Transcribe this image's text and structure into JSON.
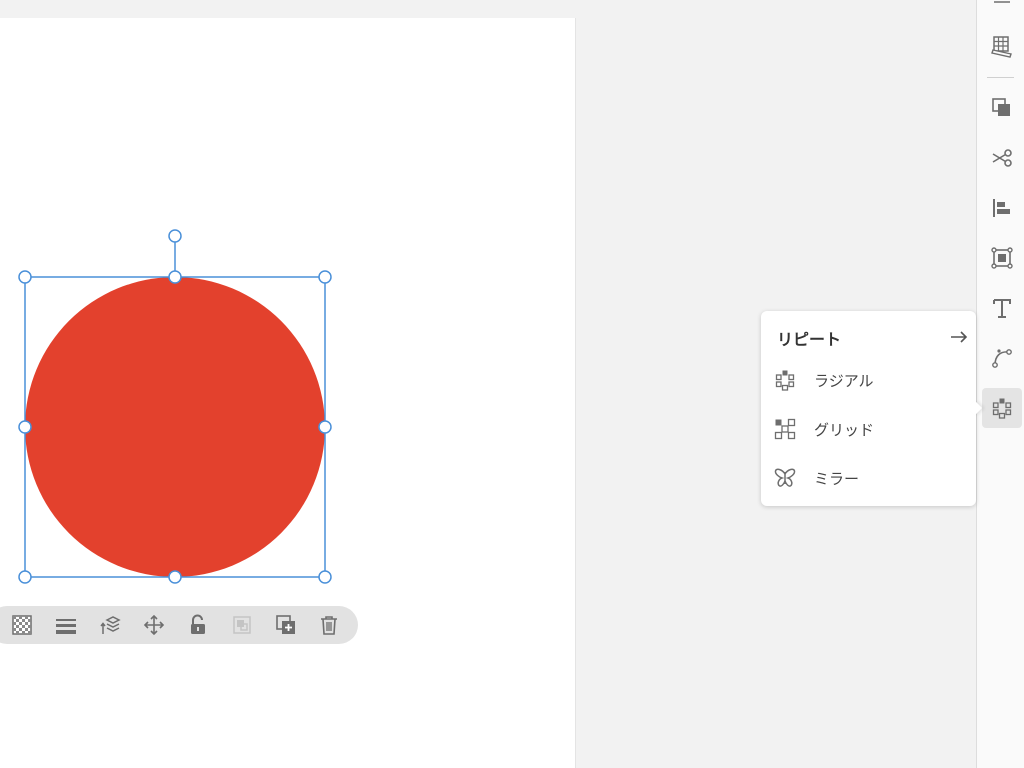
{
  "colors": {
    "accent": "#4a90d9",
    "shape_fill": "#e3412d",
    "icon": "#6e6e6e",
    "canvas_bg": "#f2f2f2",
    "artboard_bg": "#ffffff"
  },
  "canvas": {
    "shape": "circle",
    "selected": true
  },
  "context_toolbar": {
    "buttons": [
      {
        "name": "opacity-button",
        "icon": "checkerboard-icon"
      },
      {
        "name": "stroke-weight-button",
        "icon": "lines-icon"
      },
      {
        "name": "arrange-button",
        "icon": "layers-icon"
      },
      {
        "name": "move-button",
        "icon": "move-icon"
      },
      {
        "name": "lock-button",
        "icon": "lock-open-icon"
      },
      {
        "name": "group-button",
        "icon": "group-icon",
        "disabled": true
      },
      {
        "name": "duplicate-button",
        "icon": "duplicate-icon"
      },
      {
        "name": "delete-button",
        "icon": "trash-icon"
      }
    ]
  },
  "right_rail": {
    "tools": [
      {
        "name": "grid-tool",
        "icon": "grid-ruler-icon"
      },
      {
        "name": "combine-shapes-tool",
        "icon": "combine-icon"
      },
      {
        "name": "cut-tool",
        "icon": "scissors-icon"
      },
      {
        "name": "align-tool",
        "icon": "align-left-icon"
      },
      {
        "name": "frame-tool",
        "icon": "frame-icon"
      },
      {
        "name": "text-tool",
        "icon": "text-icon"
      },
      {
        "name": "path-tool",
        "icon": "bezier-icon"
      },
      {
        "name": "repeat-tool",
        "icon": "radial-repeat-icon",
        "active": true
      }
    ]
  },
  "repeat_menu": {
    "title": "リピート",
    "items": [
      {
        "label": "ラジアル",
        "icon": "radial-repeat-icon"
      },
      {
        "label": "グリッド",
        "icon": "grid-repeat-icon"
      },
      {
        "label": "ミラー",
        "icon": "mirror-butterfly-icon"
      }
    ]
  }
}
